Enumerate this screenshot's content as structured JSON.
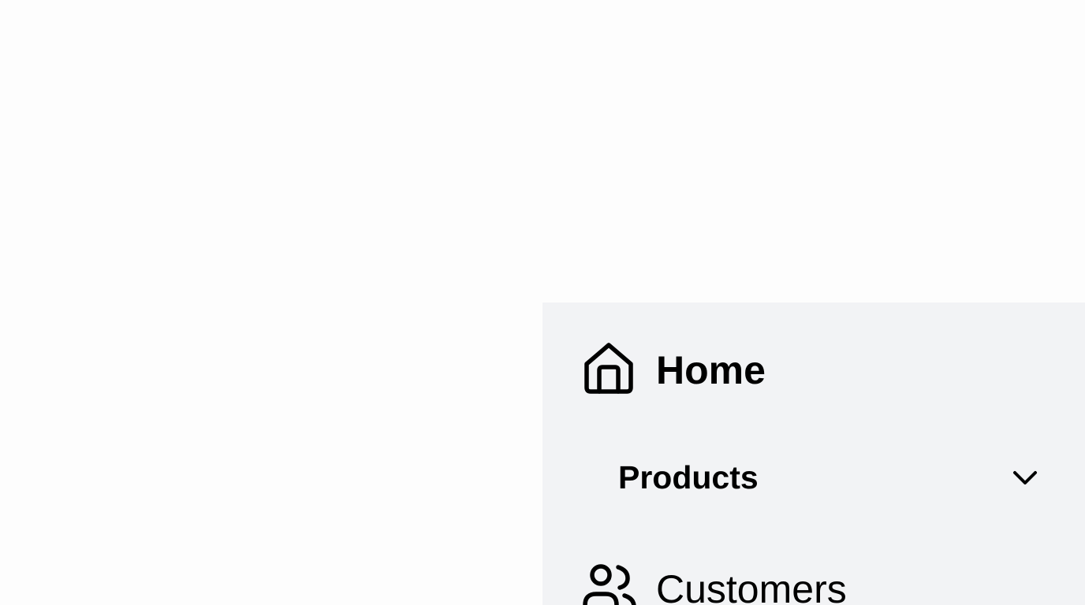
{
  "nav": {
    "items": [
      {
        "label": "Home",
        "icon": "home-icon"
      },
      {
        "label": "Products",
        "icon": "chevron-down-icon",
        "expanded": false
      },
      {
        "label": "Customers",
        "icon": "users-icon"
      }
    ]
  },
  "colors": {
    "page_background": "#fdfdfd",
    "sidebar_background": "#f2f3f5",
    "text": "#000000"
  }
}
